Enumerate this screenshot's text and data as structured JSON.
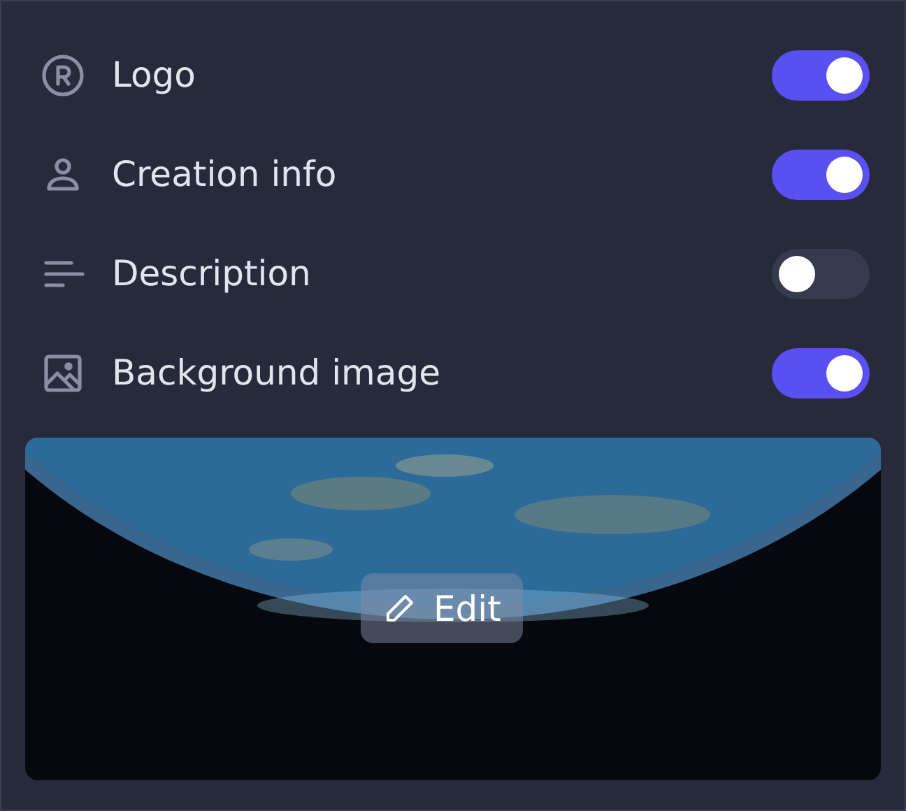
{
  "settings": [
    {
      "label": "Logo",
      "on": true
    },
    {
      "label": "Creation info",
      "on": true
    },
    {
      "label": "Description",
      "on": false
    },
    {
      "label": "Background image",
      "on": true
    }
  ],
  "preview": {
    "kind": "picture",
    "button": "Edit"
  }
}
